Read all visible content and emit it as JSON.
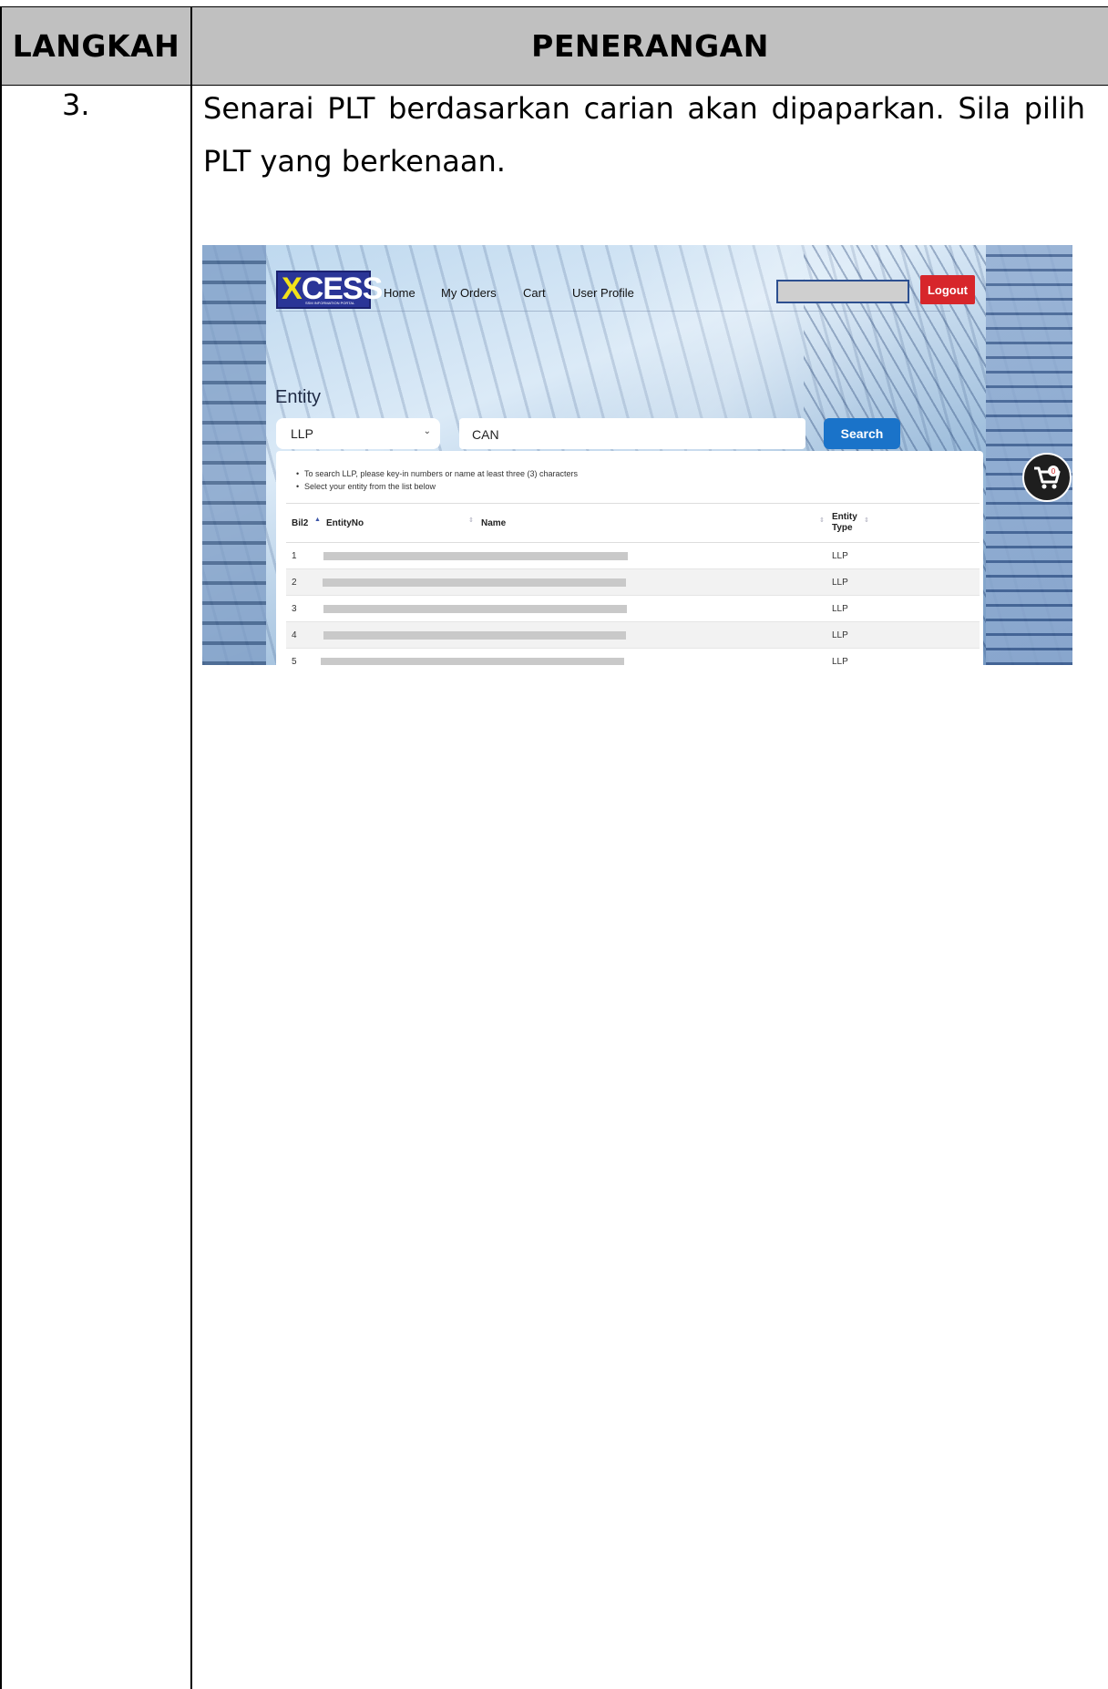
{
  "table": {
    "header_step": "LANGKAH",
    "header_desc": "PENERANGAN",
    "step_number": "3.",
    "description": "Senarai PLT berdasarkan carian akan dipaparkan. Sila pilih PLT yang berkenaan."
  },
  "screenshot": {
    "logo": {
      "x_letter": "X",
      "rest": "CESS",
      "sub": "SSM INFORMATION PORTAL"
    },
    "nav": [
      "Home",
      "My Orders",
      "Cart",
      "User Profile"
    ],
    "logout_label": "Logout",
    "entity_title": "Entity",
    "entity_type_select": "LLP",
    "search_value": "CAN",
    "search_button": "Search",
    "hints": [
      "To search LLP, please key-in numbers or name at least three (3) characters",
      "Select your entity from the list below"
    ],
    "columns": [
      "Bil2",
      "EntityNo",
      "Name",
      "Entity Type"
    ],
    "rows": [
      {
        "bil": "1",
        "type": "LLP"
      },
      {
        "bil": "2",
        "type": "LLP"
      },
      {
        "bil": "3",
        "type": "LLP"
      },
      {
        "bil": "4",
        "type": "LLP"
      },
      {
        "bil": "5",
        "type": "LLP"
      }
    ],
    "cart_count": "0"
  }
}
